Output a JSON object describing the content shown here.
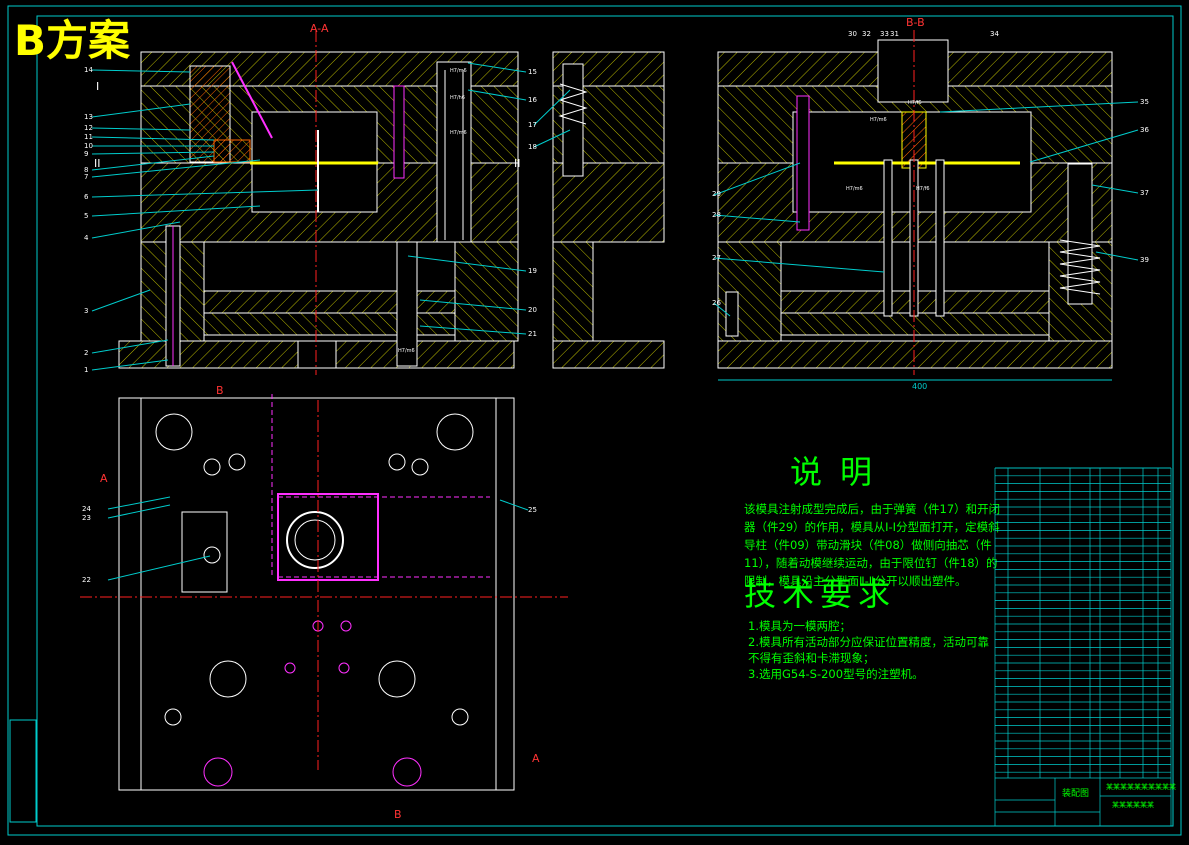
{
  "title": "B方案",
  "sections": {
    "aa": "A-A",
    "bb": "B-B",
    "plane1": "I",
    "plane2": "II",
    "plane2r": "II",
    "marker_a": "A",
    "marker_b": "B",
    "marker_a2": "A",
    "marker_b2": "B"
  },
  "callouts_left": [
    "14",
    "13",
    "12",
    "11",
    "10",
    "9",
    "8",
    "7",
    "6",
    "5",
    "4",
    "3",
    "2",
    "1"
  ],
  "callouts_mid": [
    "15",
    "16",
    "17",
    "18",
    "19",
    "20",
    "21"
  ],
  "callouts_right": [
    "30",
    "32",
    "33",
    "31",
    "34",
    "35",
    "36",
    "37",
    "39",
    "29",
    "28",
    "27",
    "26"
  ],
  "callouts_plan": [
    "24",
    "23",
    "22",
    "25"
  ],
  "dimension": "400",
  "fits": [
    "H7/m6",
    "H7/h6",
    "H7/m6",
    "H7/m6",
    "H7/f6",
    "H7/m6",
    "H7/f6",
    "H7/m6"
  ],
  "notes": {
    "heading": "说明",
    "body": "该模具注射成型完成后，由于弹簧（件17）和开闭器（件29）的作用，模具从Ⅰ-Ⅰ分型面打开，定模斜导柱（件09）带动滑块（件08）做侧向抽芯（件11），随着动模继续运动，由于限位钉（件18）的限制，模具沿主分型面Ⅱ-Ⅱ分开以顺出塑件。"
  },
  "requirements": {
    "heading": "技术要求",
    "items": [
      "1.模具为一模两腔；",
      "2.模具所有活动部分应保证位置精度，活动可靠不得有歪斜和卡滞现象；",
      "3.选用G54-S-200型号的注塑机。"
    ]
  },
  "title_block": {
    "name": "装配图",
    "school": "某某某某某某某某某某",
    "drawing": "某某某某某某"
  },
  "colors": {
    "background": "#000000",
    "outline": "#ffffff",
    "hatch": "#c8c800",
    "centerline": "#ff2020",
    "leader": "#00ffff",
    "pin": "#ff30ff",
    "text": "#00ff00",
    "title": "#ffff00"
  }
}
